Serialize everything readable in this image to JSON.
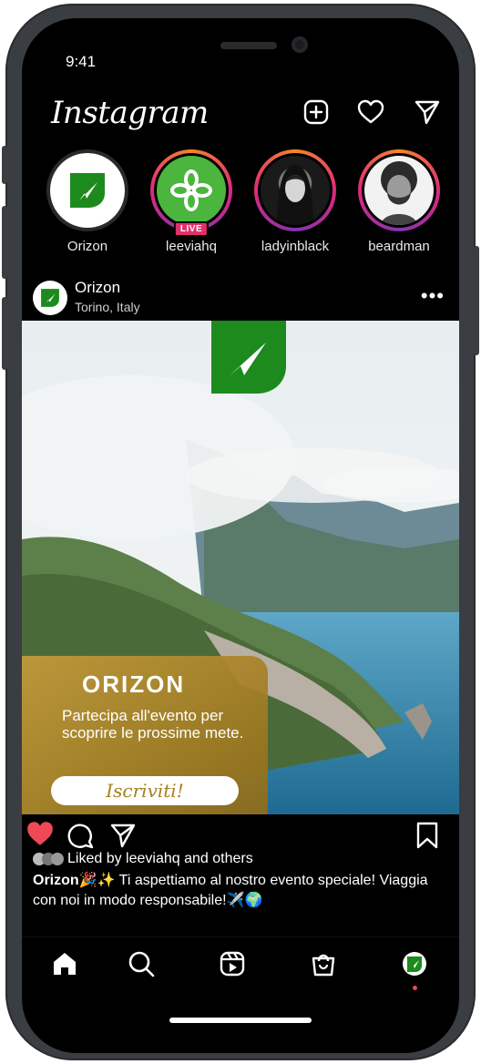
{
  "status_bar": {
    "time": "9:41"
  },
  "header": {
    "logo": "Instagram",
    "icons": [
      "add-post-icon",
      "heart-icon",
      "direct-message-icon"
    ]
  },
  "stories": [
    {
      "username": "Orizon",
      "live": false,
      "own": true
    },
    {
      "username": "leeviahq",
      "live": true,
      "badge": "LIVE"
    },
    {
      "username": "ladyinblack",
      "live": false
    },
    {
      "username": "beardman",
      "live": false
    }
  ],
  "post": {
    "username": "Orizon",
    "location": "Torino, Italy",
    "image": {
      "brand": "ORIZON",
      "tagline": "Partecipa all'evento per scoprire le prossime mete.",
      "cta": "Iscriviti!"
    },
    "liked_by": "Liked by leeviahq and others",
    "caption_user": "Orizon",
    "caption_text": "🎉✨ Ti aspettiamo al nostro evento speciale! Viaggia con noi in modo responsabile!✈️🌍"
  },
  "tabbar": [
    "home-icon",
    "search-icon",
    "reels-icon",
    "shop-icon",
    "profile-icon"
  ],
  "colors": {
    "brand_green": "#1d8a1d",
    "like_red": "#ed4956",
    "cta_gold": "#a8801e"
  }
}
